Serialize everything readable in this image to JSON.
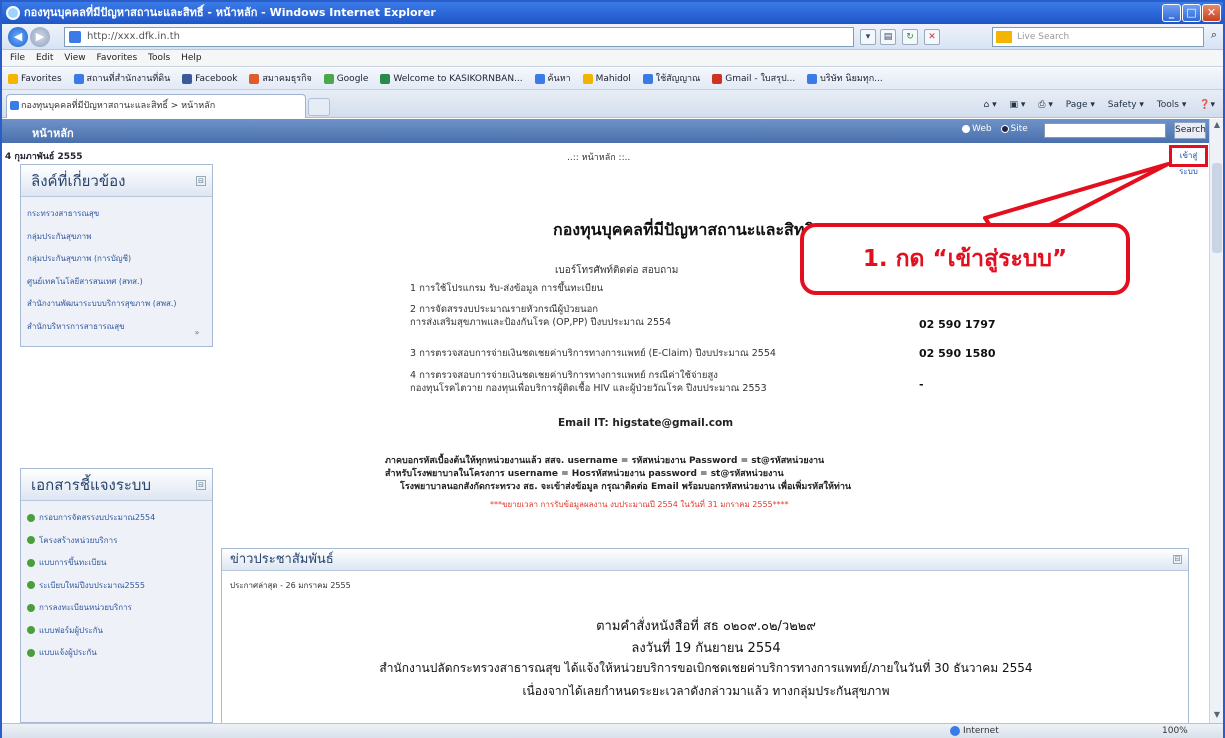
{
  "window": {
    "title": "กองทุนบุคคลที่มีปัญหาสถานะและสิทธิ์ - หน้าหลัก - Windows Internet Explorer"
  },
  "browser": {
    "address": "http://xxx.dfk.in.th",
    "live_search_placeholder": "Live Search",
    "menu": [
      "File",
      "Edit",
      "View",
      "Favorites",
      "Tools",
      "Help"
    ],
    "favorites_label": "Favorites",
    "favorites": [
      {
        "label": "สถานที่สำนักงานที่ดิน",
        "color": "#3b7be8"
      },
      {
        "label": "Facebook",
        "color": "#3b5998"
      },
      {
        "label": "สมาคมธุรกิจ",
        "color": "#e05a2a"
      },
      {
        "label": "Google",
        "color": "#4aa84a"
      },
      {
        "label": "Welcome to KASIKORNBAN...",
        "color": "#2a8a4a"
      },
      {
        "label": "ค้นหา",
        "color": "#3b7be8"
      },
      {
        "label": "Mahidol",
        "color": "#f0b400"
      },
      {
        "label": "ใช้สัญญาณ",
        "color": "#3b7be8"
      },
      {
        "label": "Gmail - ใบสรุป...",
        "color": "#cc3322"
      },
      {
        "label": "บริษัท นิยมทุก...",
        "color": "#3b7be8"
      }
    ],
    "tab_title": "กองทุนบุคคลที่มีปัญหาสถานะและสิทธิ์ > หน้าหลัก",
    "command_bar": [
      "Page ▾",
      "Safety ▾",
      "Tools ▾"
    ],
    "status_internet": "Internet",
    "status_zoom": "100%"
  },
  "site": {
    "home_label": "หน้าหลัก",
    "radio_web": "Web",
    "radio_site": "Site",
    "search_button": "Search",
    "date": "4 กุมภาพันธ์ 2555",
    "breadcrumb": "..:: หน้าหลัก ::..",
    "login_link": "เข้าสู่ระบบ"
  },
  "sidebar": {
    "related_title": "ลิงค์ที่เกี่ยวข้อง",
    "related_links": [
      "กระทรวงสาธารณสุข",
      "กลุ่มประกันสุขภาพ",
      "กลุ่มประกันสุขภาพ (การบัญชี)",
      "ศูนย์เทคโนโลยีสารสนเทศ (สทส.)",
      "สำนักงานพัฒนาระบบบริการสุขภาพ (สพส.)",
      "สำนักบริหารการสาธารณสุข"
    ],
    "docs_title": "เอกสารชี้แจงระบบ",
    "docs_links": [
      "กรอบการจัดสรรงบประมาณ2554",
      "โครงสร้างหน่วยบริการ",
      "แบบการขึ้นทะเบียน",
      "ระเบียบใหม่ปีงบประมาณ2555",
      "การลงทะเบียนหน่วยบริการ",
      "แบบฟอร์มผู้ประกัน",
      "แบบแจ้งผู้ประกัน"
    ]
  },
  "main": {
    "title": "กองทุนบุคคลที่มีปัญหาสถานะและสิทธิ",
    "phone_header": "เบอร์โทรศัพท์ติดต่อ สอบถาม",
    "items": [
      {
        "lines": [
          "1 การใช้โปรแกรม รับ-ส่งข้อมูล การขึ้นทะเบียน"
        ],
        "phone": ""
      },
      {
        "lines": [
          "2 การจัดสรรงบประมาณรายหัวกรณีผู้ป่วยนอก",
          "   การส่งเสริมสุขภาพและป้องกันโรค (OP,PP) ปีงบประมาณ 2554"
        ],
        "phone": "02 590 1797"
      },
      {
        "lines": [
          "3 การตรวจสอบการจ่ายเงินชดเชยค่าบริการทางการแพทย์ (E-Claim) ปีงบประมาณ 2554"
        ],
        "phone": "02 590 1580"
      },
      {
        "lines": [
          "4 การตรวจสอบการจ่ายเงินชดเชยค่าบริการทางการแพทย์ กรณีค่าใช้จ่ายสูง",
          "   กองทุนโรคไตวาย กองทุนเพื่อบริการผู้ติดเชื้อ HIV และผู้ป่วยวัณโรค ปีงบประมาณ 2553"
        ],
        "phone": "-"
      }
    ],
    "email": "Email IT: higstate@gmail.com",
    "username_lines": [
      "ภาคบอกรหัสเบื้องต้นให้ทุกหน่วยงานแล้ว   สสจ. username  =  รหัสหน่วยงาน        Password = st@รหัสหน่วยงาน",
      "สำหรับโรงพยาบาลในโครงการ                         username  =  Hosรหัสหน่วยงาน    password = st@รหัสหน่วยงาน",
      "โรงพยาบาลนอกสังกัดกระทรวง สธ. จะเข้าส่งข้อมูล กรุณาติดต่อ Email พร้อมบอกรหัสหน่วยงาน เพื่อเพิ่มรหัสให้ท่าน"
    ],
    "red_notice": "***ขยายเวลา การรับข้อมูลผลงาน งบประมาณปี 2554 ในวันที่ 31 มกราคม 2555****"
  },
  "news": {
    "title": "ข่าวประชาสัมพันธ์",
    "date": "ประกาศล่าสุด - 26 มกราคม 2555",
    "lines": [
      "ตามคำสั่งหนังสือที่ สธ ๐๒๐๙.๐๒/ว๒๒๙",
      "ลงวันที่ 19 กันยายน 2554",
      "สำนักงานปลัดกระทรวงสาธารณสุข ได้แจ้งให้หน่วยบริการขอเบิกชดเชยค่าบริการทางการแพทย์/ภายในวันที่ 30 ธันวาคม 2554",
      "เนื่องจากได้เลยกำหนดระยะเวลาดังกล่าวมาแล้ว ทางกลุ่มประกันสุขภาพ"
    ]
  },
  "annotation": {
    "text": "1. กด “เข้าสู่ระบบ”",
    "color": "#e30e1e"
  }
}
